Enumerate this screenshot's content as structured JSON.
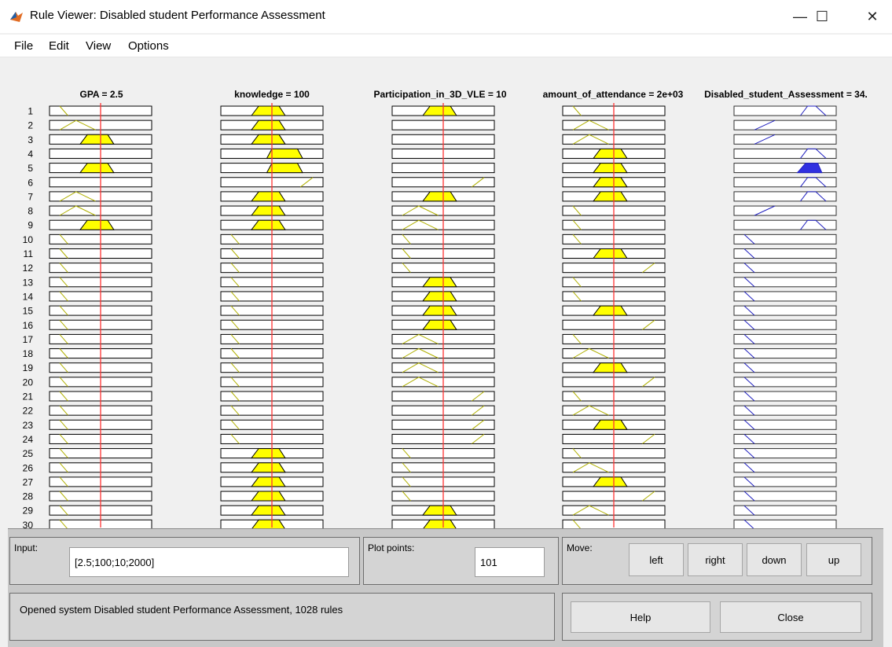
{
  "window": {
    "title": "Rule Viewer: Disabled student Performance Assessment",
    "minimize_glyph": "—",
    "maximize_glyph": "☐",
    "close_glyph": "✕"
  },
  "menu": [
    "File",
    "Edit",
    "View",
    "Options"
  ],
  "colors": {
    "input_mf_fill": "#ffff00",
    "input_mf_line": "#b0b000",
    "output_mf_line": "#2020c0",
    "output_mf_fill": "#3030e0",
    "crosshair": "#ff3333",
    "plot_background": "#f0f0f0"
  },
  "columns": [
    {
      "header": "GPA = 2.5"
    },
    {
      "header": "knowledge = 100"
    },
    {
      "header": "Participation_in_3D_VLE = 10"
    },
    {
      "header": "amount_of_attendance = 2e+03"
    },
    {
      "header": "Disabled_student_Assessment = 34."
    }
  ],
  "rule_numbers": [
    "1",
    "2",
    "3",
    "4",
    "5",
    "6",
    "7",
    "8",
    "9",
    "10",
    "11",
    "12",
    "13",
    "14",
    "15",
    "16",
    "17",
    "18",
    "19",
    "20",
    "21",
    "22",
    "23",
    "24",
    "25",
    "26",
    "27",
    "28",
    "29",
    "30"
  ],
  "rules": [
    [
      "low0",
      "mid",
      "mid",
      "low0",
      "out_hi"
    ],
    [
      "mid0",
      "mid1",
      "none",
      "mid0",
      "out_mid"
    ],
    [
      "mid1",
      "mid1",
      "none",
      "mid0",
      "out_mid"
    ],
    [
      "none",
      "high1",
      "none",
      "mid1",
      "out_hi"
    ],
    [
      "mid1",
      "high1",
      "none",
      "mid1",
      "out_hi_fill"
    ],
    [
      "none",
      "high0",
      "high0",
      "mid1",
      "out_hi"
    ],
    [
      "mid0",
      "mid1",
      "mid1",
      "mid1",
      "out_hi"
    ],
    [
      "mid0",
      "mid1",
      "mid0",
      "low0",
      "out_mid"
    ],
    [
      "mid1",
      "mid1",
      "mid0",
      "low0",
      "out_hi"
    ],
    [
      "low0",
      "low0",
      "low0",
      "low0",
      "out_low"
    ],
    [
      "low0",
      "low0",
      "low0",
      "mid1",
      "out_low"
    ],
    [
      "low0",
      "low0",
      "low0",
      "high0",
      "out_low"
    ],
    [
      "low0",
      "low0",
      "mid1",
      "low0",
      "out_low"
    ],
    [
      "low0",
      "low0",
      "mid1",
      "low0",
      "out_low"
    ],
    [
      "low0",
      "low0",
      "mid1",
      "mid1",
      "out_low"
    ],
    [
      "low0",
      "low0",
      "mid1",
      "high0",
      "out_low"
    ],
    [
      "low0",
      "low0",
      "mid0",
      "low0",
      "out_low"
    ],
    [
      "low0",
      "low0",
      "mid0",
      "mid0",
      "out_low"
    ],
    [
      "low0",
      "low0",
      "mid0",
      "mid1",
      "out_low"
    ],
    [
      "low0",
      "low0",
      "mid0",
      "high0",
      "out_low"
    ],
    [
      "low0",
      "low0",
      "high0",
      "low0",
      "out_low"
    ],
    [
      "low0",
      "low0",
      "high0",
      "mid0",
      "out_low"
    ],
    [
      "low0",
      "low0",
      "high0",
      "mid1",
      "out_low"
    ],
    [
      "low0",
      "low0",
      "high0",
      "high0",
      "out_low"
    ],
    [
      "low0",
      "mid1",
      "low0",
      "low0",
      "out_low"
    ],
    [
      "low0",
      "mid1",
      "low0",
      "mid0",
      "out_low"
    ],
    [
      "low0",
      "mid1",
      "low0",
      "mid1",
      "out_low"
    ],
    [
      "low0",
      "mid1",
      "low0",
      "high0",
      "out_low"
    ],
    [
      "low0",
      "mid1",
      "mid1",
      "mid0",
      "out_low"
    ],
    [
      "low0",
      "mid1",
      "mid1",
      "low0",
      "out_low"
    ]
  ],
  "crosshair_fraction": [
    0.5,
    0.5,
    0.5,
    0.5
  ],
  "input_panel": {
    "label": "Input:",
    "value": "[2.5;100;10;2000]"
  },
  "plot_points": {
    "label": "Plot points:",
    "value": "101"
  },
  "move": {
    "label": "Move:",
    "left": "left",
    "right": "right",
    "down": "down",
    "up": "up"
  },
  "status": "Opened system Disabled student Performance Assessment, 1028 rules",
  "buttons": {
    "help": "Help",
    "close": "Close"
  }
}
